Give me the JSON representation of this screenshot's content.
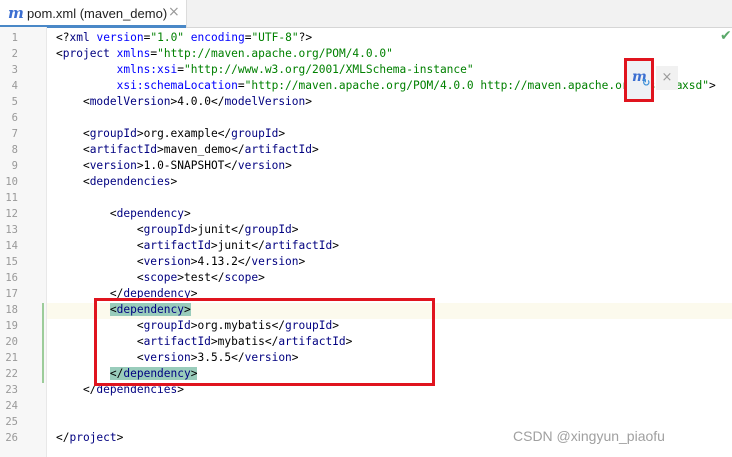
{
  "tab": {
    "icon": "maven-m-icon",
    "title": "pom.xml (maven_demo)",
    "close": "×"
  },
  "line_numbers": [
    "1",
    "2",
    "3",
    "4",
    "5",
    "6",
    "7",
    "8",
    "9",
    "10",
    "11",
    "12",
    "13",
    "14",
    "15",
    "16",
    "17",
    "18",
    "19",
    "20",
    "21",
    "22",
    "23",
    "24",
    "25",
    "26"
  ],
  "code": {
    "l1": {
      "decl_open": "<?",
      "decl_name": "xml",
      "version_attr": "version",
      "version_val": "\"1.0\"",
      "encoding_attr": "encoding",
      "encoding_val": "\"UTF-8\"",
      "decl_close": "?>"
    },
    "l2": {
      "tag": "project",
      "attr": "xmlns",
      "val": "\"http://maven.apache.org/POM/4.0.0\""
    },
    "l3": {
      "attr": "xmlns:xsi",
      "val": "\"http://www.w3.org/2001/XMLSchema-instance\""
    },
    "l4": {
      "attr": "xsi:schemaLocation",
      "val_a": "\"http://maven.apache.org/POM/4.0.0 http://maven.apache.org/xsd/ma",
      "val_b": "xsd\""
    },
    "l5": {
      "tag": "modelVersion",
      "value": "4.0.0"
    },
    "l7": {
      "tag": "groupId",
      "value": "org.example"
    },
    "l8": {
      "tag": "artifactId",
      "value": "maven_demo"
    },
    "l9": {
      "tag": "version",
      "value": "1.0-SNAPSHOT"
    },
    "l10": {
      "tag": "dependencies"
    },
    "l12": {
      "tag": "dependency"
    },
    "l13": {
      "tag": "groupId",
      "value": "junit"
    },
    "l14": {
      "tag": "artifactId",
      "value": "junit"
    },
    "l15": {
      "tag": "version",
      "value": "4.13.2"
    },
    "l16": {
      "tag": "scope",
      "value": "test"
    },
    "l17": {
      "tag": "dependency"
    },
    "l18": {
      "tag": "dependency"
    },
    "l19": {
      "tag": "groupId",
      "value": "org.mybatis"
    },
    "l20": {
      "tag": "artifactId",
      "value": "mybatis"
    },
    "l21": {
      "tag": "version",
      "value": "3.5.5"
    },
    "l22": {
      "tag": "dependency"
    },
    "l23": {
      "tag": "dependencies"
    },
    "l26": {
      "tag": "project"
    }
  },
  "popup": {
    "icon": "maven-reload-icon",
    "close": "×"
  },
  "status_icon": "checkmark-icon",
  "watermark": "CSDN @xingyun_piaofu",
  "colors": {
    "tag": "#000080",
    "attr": "#0000ff",
    "value": "#008000",
    "highlight_box": "#e0141e",
    "brace_match": "#99ccbb"
  }
}
